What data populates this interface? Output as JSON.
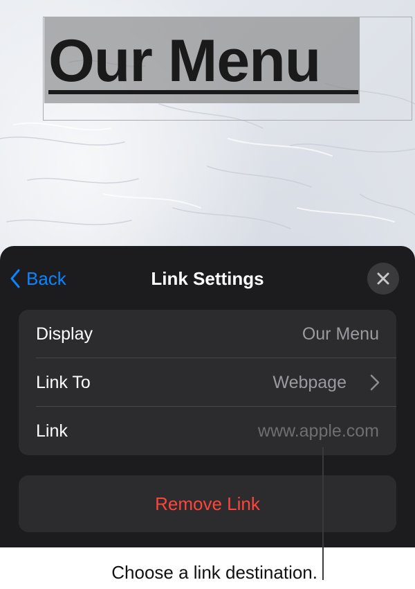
{
  "canvas": {
    "title": "Our Menu"
  },
  "link_settings": {
    "back_label": "Back",
    "title": "Link Settings",
    "close_icon": "close-icon",
    "rows": [
      {
        "label": "Display",
        "value": "Our Menu"
      },
      {
        "label": "Link To",
        "value": "Webpage"
      },
      {
        "label": "Link",
        "value": "www.apple.com"
      }
    ],
    "remove_label": "Remove Link"
  },
  "callout": {
    "text": "Choose a link destination."
  },
  "colors": {
    "accent": "#0a84ff",
    "destructive": "#ff453a",
    "panel_bg": "#1c1c1e",
    "group_bg": "#2c2c2e"
  }
}
